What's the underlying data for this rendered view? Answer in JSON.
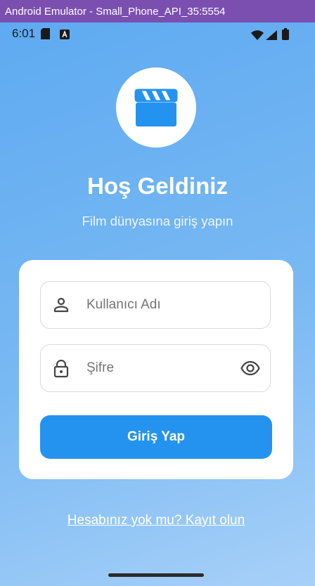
{
  "window": {
    "title": "Android Emulator - Small_Phone_API_35:5554"
  },
  "statusbar": {
    "time": "6:01",
    "icons": [
      "sd-card-icon",
      "a-notification-icon",
      "wifi-icon",
      "signal-icon",
      "battery-icon"
    ]
  },
  "app": {
    "logo_icon": "clapperboard-icon",
    "title": "Hoş Geldiniz",
    "subtitle": "Film dünyasına giriş yapın"
  },
  "form": {
    "username_placeholder": "Kullanıcı Adı",
    "password_placeholder": "Şifre",
    "login_button": "Giriş Yap"
  },
  "register_link": "Hesabınız yok mu? Kayıt olun",
  "colors": {
    "background_top": "#5eaaf1",
    "background_bottom": "#a7d0f8",
    "accent": "#2493ef",
    "titlebar": "#7b4fb0"
  }
}
